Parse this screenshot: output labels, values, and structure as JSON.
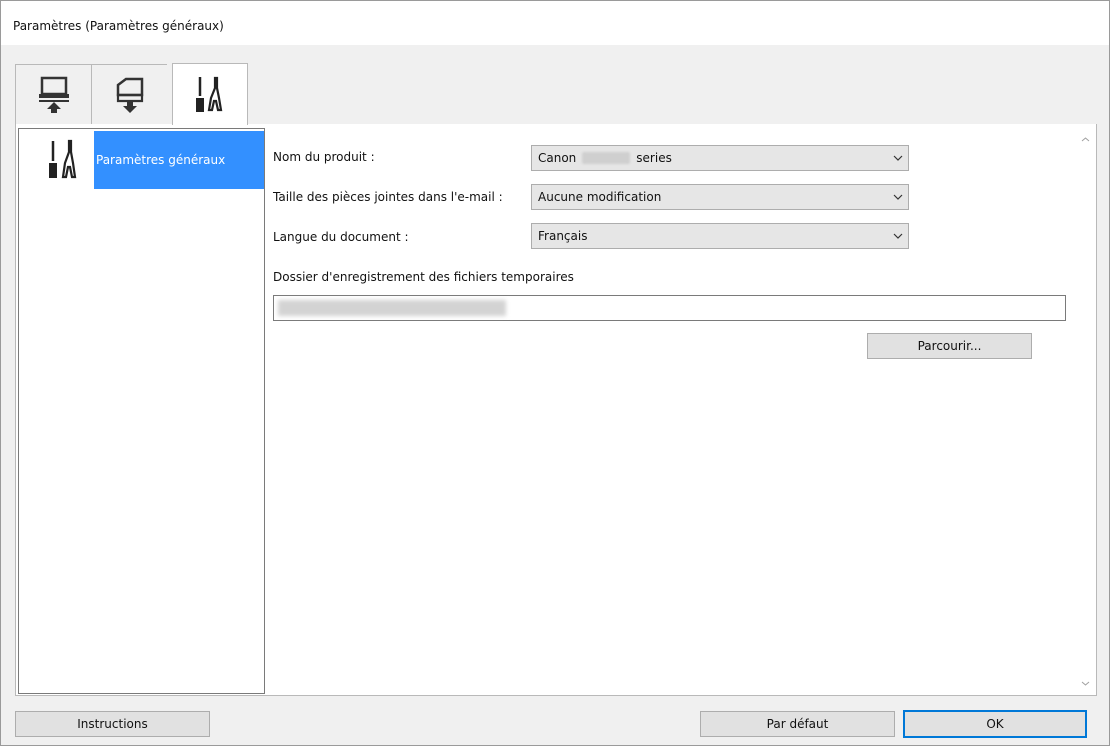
{
  "window": {
    "title": "Paramètres (Paramètres généraux)"
  },
  "tabs": [
    {
      "icon": "computer-upload-icon",
      "active": false
    },
    {
      "icon": "scanner-download-icon",
      "active": false
    },
    {
      "icon": "tools-icon",
      "active": true
    }
  ],
  "sidebar": {
    "items": [
      {
        "icon": "tools-icon",
        "label": "Paramètres généraux",
        "selected": true
      }
    ]
  },
  "form": {
    "product_label": "Nom du produit :",
    "product_value_prefix": "Canon",
    "product_value_suffix": "series",
    "attachment_label": "Taille des pièces jointes dans l'e-mail :",
    "attachment_value": "Aucune modification",
    "language_label": "Langue du document :",
    "language_value": "Français",
    "folder_label": "Dossier d'enregistrement des fichiers temporaires",
    "browse_label": "Parcourir..."
  },
  "footer": {
    "instructions_label": "Instructions",
    "default_label": "Par défaut",
    "ok_label": "OK"
  },
  "colors": {
    "selection": "#3390ff",
    "default_button_border": "#0078d7"
  }
}
